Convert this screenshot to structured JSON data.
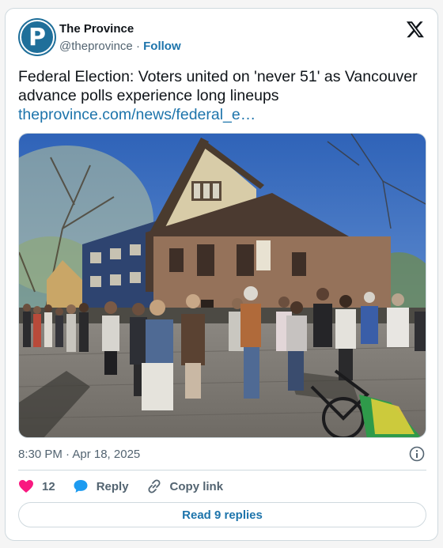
{
  "account": {
    "name": "The Province",
    "handle": "@theprovince",
    "separator": "·",
    "follow_label": "Follow",
    "avatar_letter": "P"
  },
  "tweet": {
    "text": "Federal Election: Voters united on 'never 51' as Vancouver advance polls experience long lineups",
    "link": "theprovince.com/news/federal_e…",
    "timestamp": "8:30 PM · Apr 18, 2025"
  },
  "actions": {
    "likes": "12",
    "reply_label": "Reply",
    "copy_link_label": "Copy link",
    "read_replies_label": "Read 9 replies"
  },
  "colors": {
    "brand_blue": "#1d74ab",
    "heart_pink": "#f91880",
    "text_gray": "#536471",
    "border": "#cfd9de"
  },
  "icons": {
    "logo": "x-logo-icon",
    "info": "info-icon",
    "like": "heart-icon",
    "reply": "reply-bubble-icon",
    "copy": "link-icon"
  }
}
